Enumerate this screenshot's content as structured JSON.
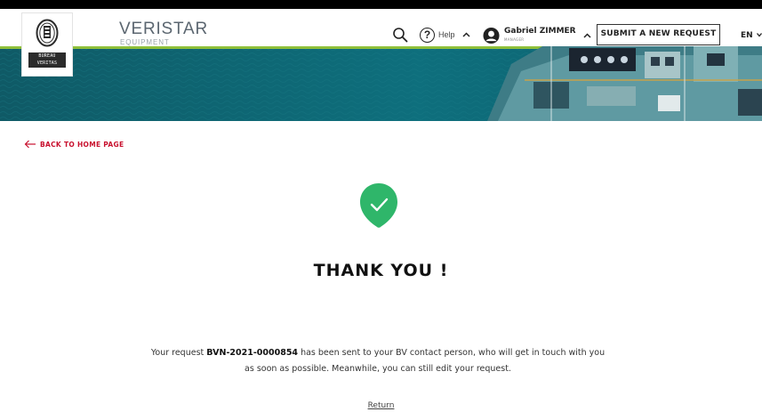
{
  "header": {
    "logo": {
      "lines": [
        "BUREAU",
        "VERITAS"
      ]
    },
    "brand": {
      "name": "VERISTAR",
      "sub": "EQUIPMENT"
    },
    "search_icon": "search-icon",
    "help_label": "Help",
    "user": {
      "name": "Gabriel ZIMMER",
      "role": "MANAGER"
    },
    "submit_button": "SUBMIT A NEW REQUEST",
    "language": "EN"
  },
  "main": {
    "back_link": "BACK TO HOME PAGE",
    "title": "THANK YOU !",
    "message": {
      "prefix": "Your request ",
      "request_id": "BVN-2021-0000854",
      "suffix": " has been sent to your BV contact person, who will get in touch with you",
      "line2": "as soon as possible. Meanwhile, you can still edit your request."
    },
    "return_link": "Return"
  },
  "colors": {
    "accent_red": "#c8102e",
    "success_green": "#2fb66a",
    "banner_sea": "#0f6a78"
  }
}
